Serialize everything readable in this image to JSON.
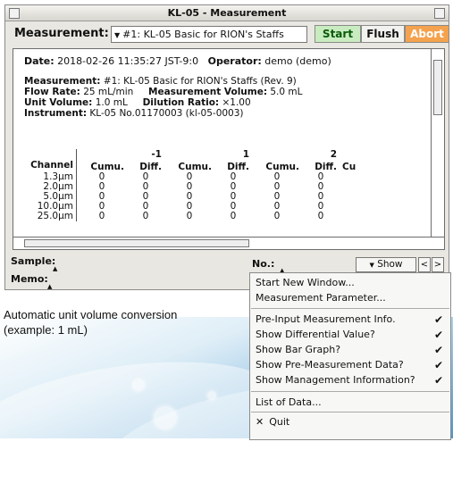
{
  "window": {
    "title": "KL-05 - Measurement"
  },
  "toolbar": {
    "measurement_label": "Measurement:",
    "measurement_value": "#1: KL-05 Basic for RION's Staffs",
    "start_label": "Start",
    "flush_label": "Flush",
    "abort_label": "Abort"
  },
  "info": {
    "date_label": "Date:",
    "date_value": "2018-02-26 11:35:27 JST-9:0",
    "operator_label": "Operator:",
    "operator_value": "demo (demo)",
    "measurement_label": "Measurement:",
    "measurement_value": "#1: KL-05 Basic for RION's Staffs (Rev. 9)",
    "flow_label": "Flow Rate:",
    "flow_value": "25 mL/min",
    "mvol_label": "Measurement Volume:",
    "mvol_value": "5.0 mL",
    "uvol_label": "Unit Volume:",
    "uvol_value": "1.0 mL",
    "dil_label": "Dilution Ratio:",
    "dil_value": "×1.00",
    "inst_label": "Instrument:",
    "inst_value": "KL-05 No.01170003 (kl-05-0003)"
  },
  "table": {
    "channel_header": "Channel",
    "groups": [
      "-1",
      "1",
      "2"
    ],
    "cumu": "Cumu.",
    "diff": "Diff.",
    "cut": "Cu",
    "rows": [
      {
        "channel": "1.3μm",
        "v": [
          "0",
          "0",
          "0",
          "0",
          "0",
          "0"
        ]
      },
      {
        "channel": "2.0μm",
        "v": [
          "0",
          "0",
          "0",
          "0",
          "0",
          "0"
        ]
      },
      {
        "channel": "5.0μm",
        "v": [
          "0",
          "0",
          "0",
          "0",
          "0",
          "0"
        ]
      },
      {
        "channel": "10.0μm",
        "v": [
          "0",
          "0",
          "0",
          "0",
          "0",
          "0"
        ]
      },
      {
        "channel": "25.0μm",
        "v": [
          "0",
          "0",
          "0",
          "0",
          "0",
          "0"
        ]
      }
    ]
  },
  "fields": {
    "sample_label": "Sample:",
    "memo_label": "Memo:",
    "no_label": "No.:",
    "show_label": "Show",
    "prev_label": "<",
    "next_label": ">"
  },
  "menu": {
    "items": [
      {
        "label": "Start New Window...",
        "checked": false
      },
      {
        "label": "Measurement Parameter...",
        "checked": false
      },
      {
        "label": "Pre-Input Measurement Info.",
        "checked": true
      },
      {
        "label": "Show Differential Value?",
        "checked": true
      },
      {
        "label": "Show Bar Graph?",
        "checked": true
      },
      {
        "label": "Show Pre-Measurement Data?",
        "checked": true
      },
      {
        "label": "Show Management Information?",
        "checked": true
      },
      {
        "label": "List of Data...",
        "checked": false
      },
      {
        "label": "Quit",
        "checked": false
      }
    ],
    "check_glyph": "✔",
    "quit_glyph": "✕"
  },
  "caption": {
    "line1": "Automatic unit volume conversion",
    "line2": "(example: 1 mL)"
  }
}
